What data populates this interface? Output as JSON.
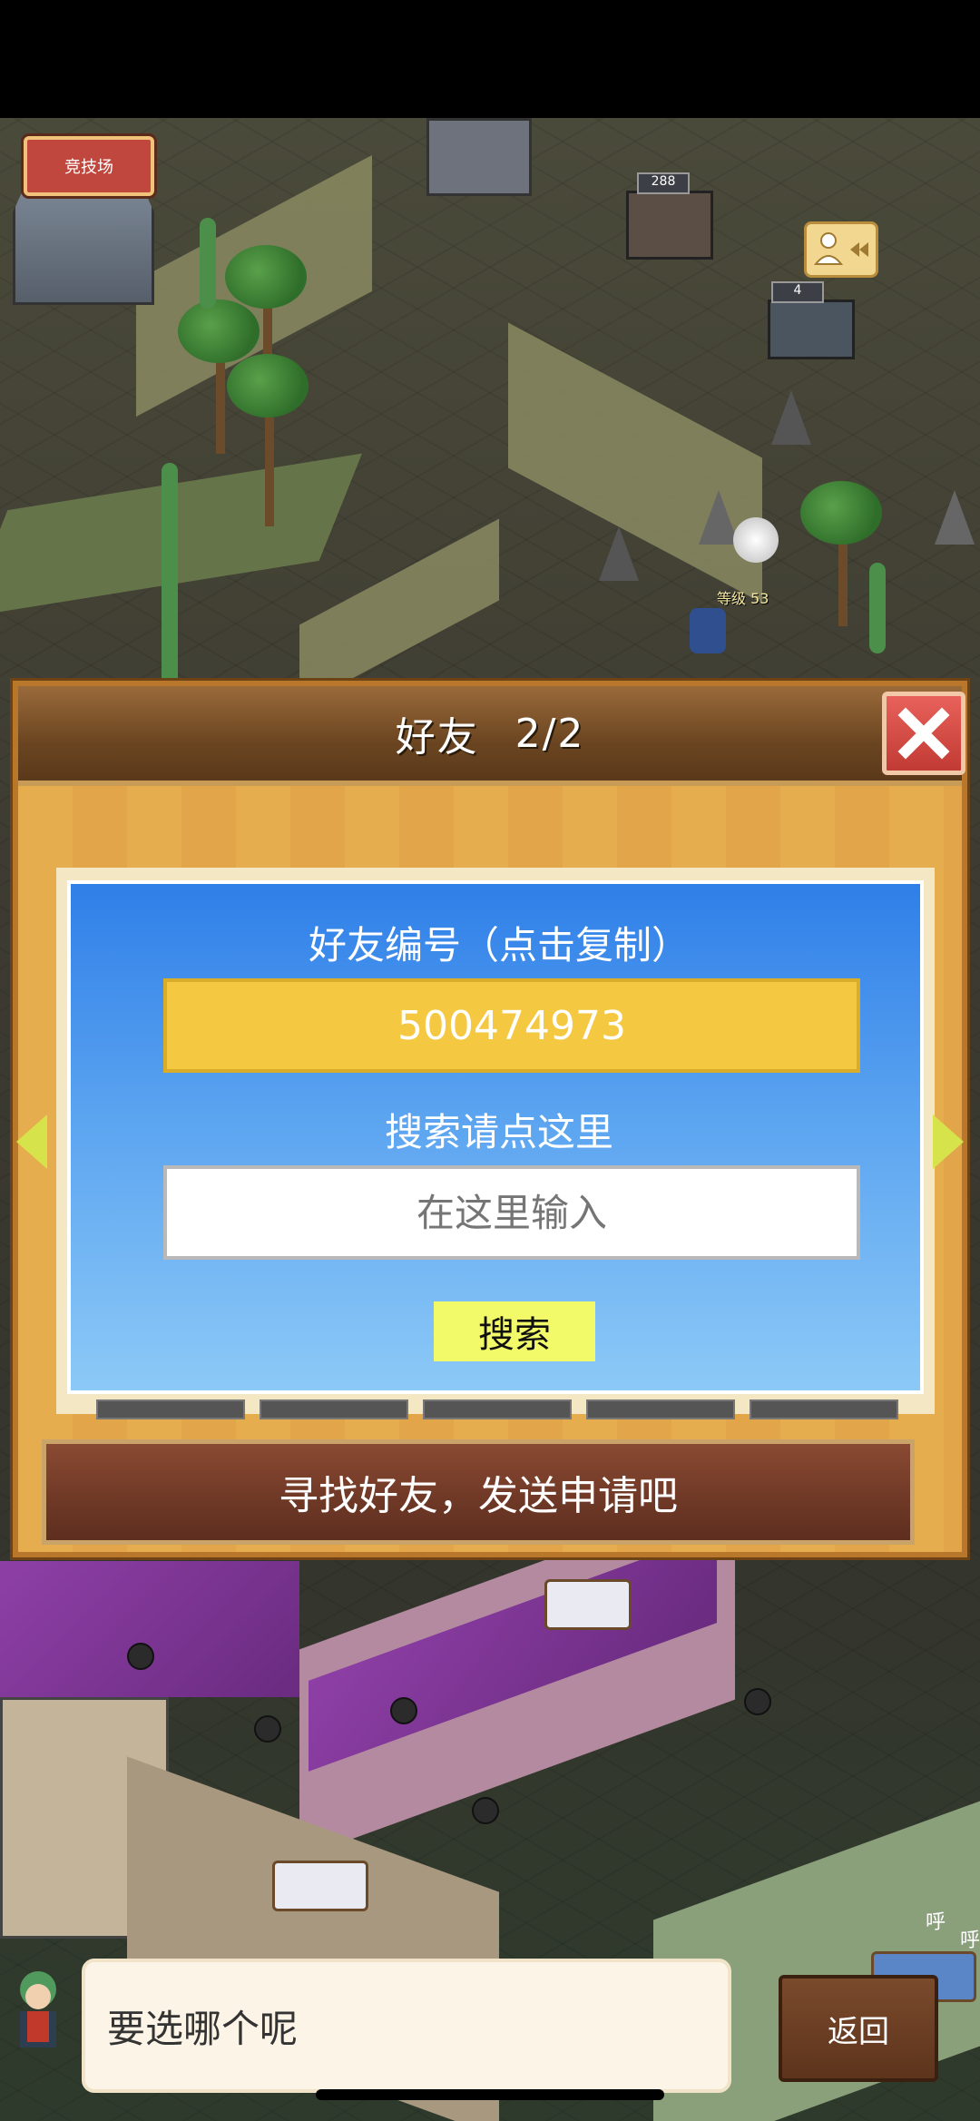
{
  "world": {
    "arena_label": "竞技场",
    "counter_a": "288",
    "counter_b": "4",
    "level_label": "等级 53",
    "shout_a": "呼",
    "shout_b": "呼"
  },
  "dialog": {
    "title": "好友",
    "page": "2/2",
    "close_icon": "close-x-icon",
    "friend_id_label": "好友编号（点击复制）",
    "friend_id": "500474973",
    "search_label": "搜索请点这里",
    "search_placeholder": "在这里输入",
    "search_button": "搜索",
    "banner": "寻找好友，发送申请吧"
  },
  "bottom": {
    "message": "要选哪个呢",
    "back_button": "返回"
  },
  "colors": {
    "dialog_frame": "#e6ad4f",
    "header": "#6b4521",
    "close_red": "#c23a34",
    "panel_blue": "#2f7fe8",
    "id_yellow": "#f5c842",
    "search_btn": "#f3fa6a",
    "banner_brown": "#6e3826"
  }
}
